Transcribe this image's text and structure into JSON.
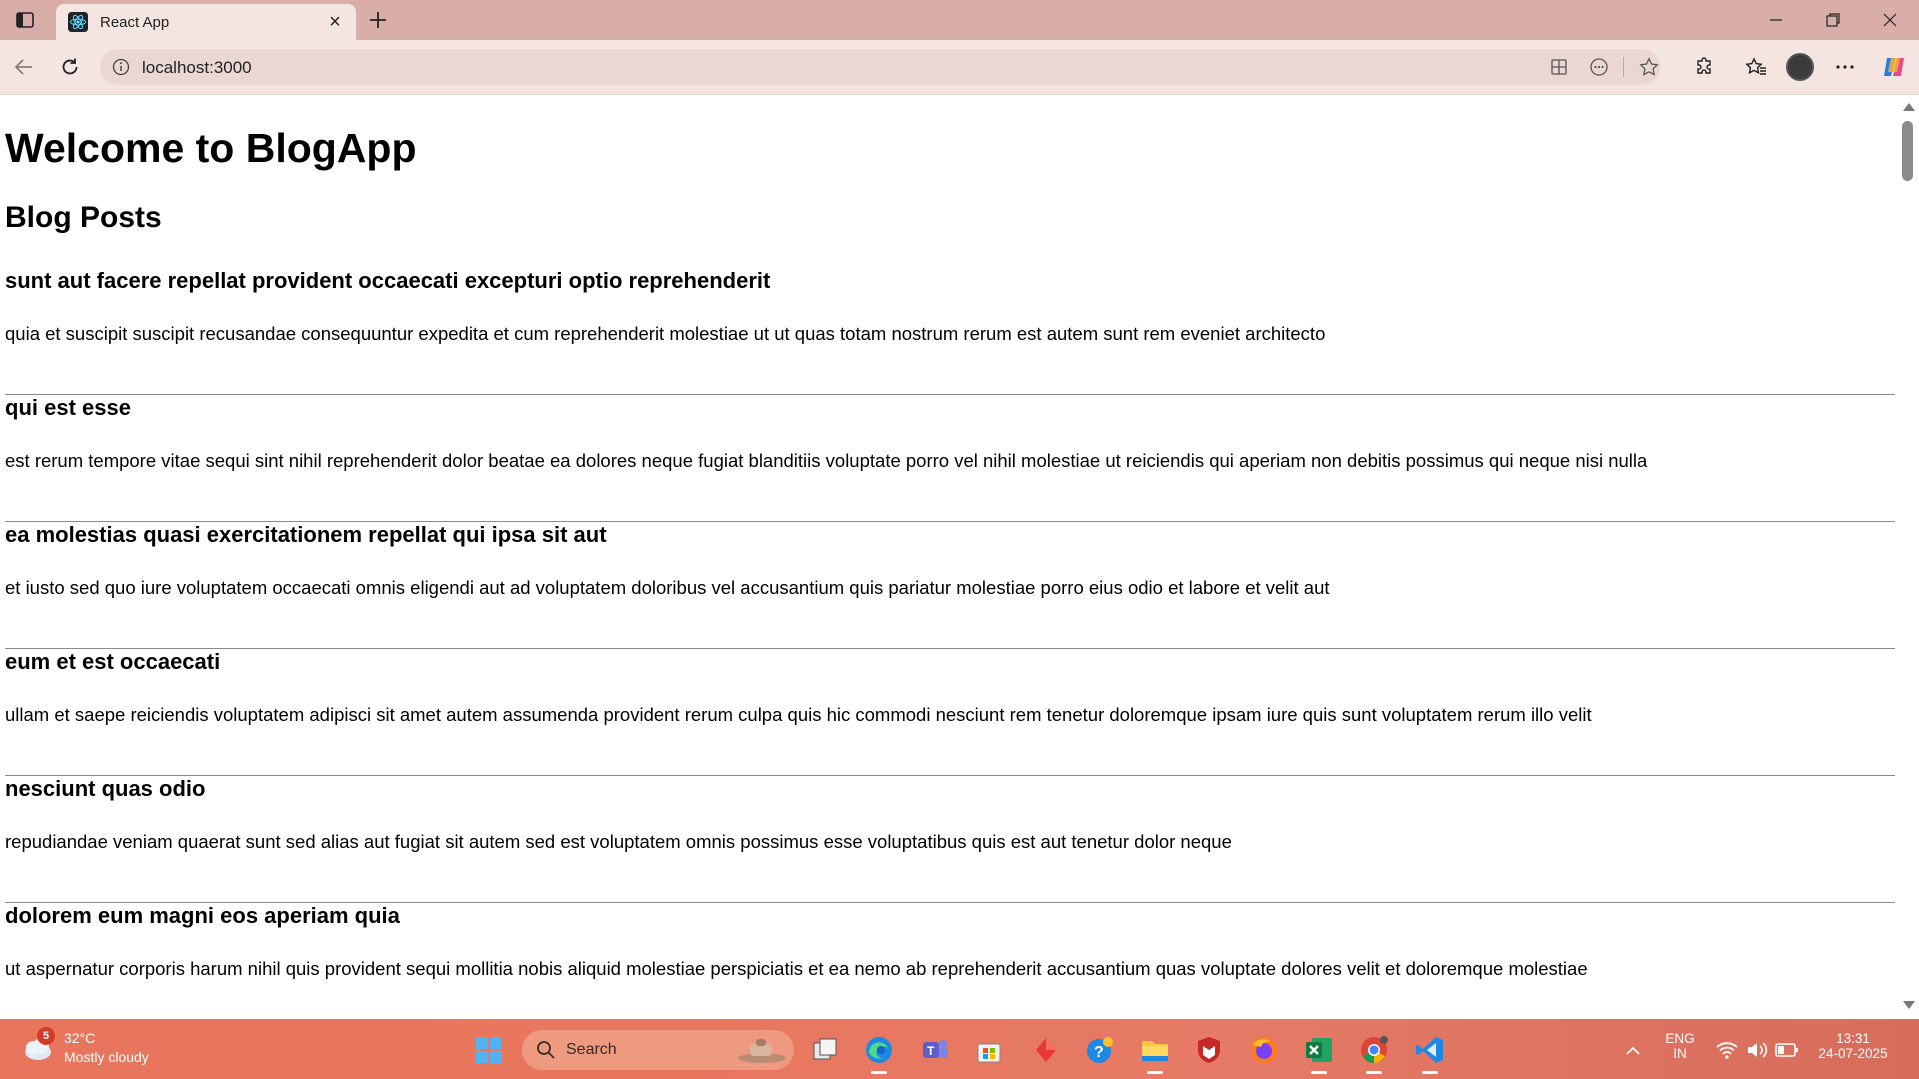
{
  "browser": {
    "tab_title": "React App",
    "tab_close": "×",
    "url": "localhost:3000"
  },
  "page": {
    "heading": "Welcome to BlogApp",
    "subheading": "Blog Posts",
    "posts": [
      {
        "title": "sunt aut facere repellat provident occaecati excepturi optio reprehenderit",
        "body": "quia et suscipit suscipit recusandae consequuntur expedita et cum reprehenderit molestiae ut ut quas totam nostrum rerum est autem sunt rem eveniet architecto"
      },
      {
        "title": "qui est esse",
        "body": "est rerum tempore vitae sequi sint nihil reprehenderit dolor beatae ea dolores neque fugiat blanditiis voluptate porro vel nihil molestiae ut reiciendis qui aperiam non debitis possimus qui neque nisi nulla"
      },
      {
        "title": "ea molestias quasi exercitationem repellat qui ipsa sit aut",
        "body": "et iusto sed quo iure voluptatem occaecati omnis eligendi aut ad voluptatem doloribus vel accusantium quis pariatur molestiae porro eius odio et labore et velit aut"
      },
      {
        "title": "eum et est occaecati",
        "body": "ullam et saepe reiciendis voluptatem adipisci sit amet autem assumenda provident rerum culpa quis hic commodi nesciunt rem tenetur doloremque ipsam iure quis sunt voluptatem rerum illo velit"
      },
      {
        "title": "nesciunt quas odio",
        "body": "repudiandae veniam quaerat sunt sed alias aut fugiat sit autem sed est voluptatem omnis possimus esse voluptatibus quis est aut tenetur dolor neque"
      },
      {
        "title": "dolorem eum magni eos aperiam quia",
        "body": "ut aspernatur corporis harum nihil quis provident sequi mollitia nobis aliquid molestiae perspiciatis et ea nemo ab reprehenderit accusantium quas voluptate dolores velit et doloremque molestiae"
      }
    ]
  },
  "taskbar": {
    "weather_badge": "5",
    "weather_temp": "32°C",
    "weather_desc": "Mostly cloudy",
    "search_label": "Search",
    "lang_line1": "ENG",
    "lang_line2": "IN",
    "time": "13:31",
    "date": "24-07-2025"
  },
  "colors": {
    "titlebar": "#d9aea9",
    "toolbar": "#f4e4e2",
    "taskbar": "#e8765c",
    "react_logo": "#61dafb"
  },
  "icons": [
    "sidebar-icon",
    "react-favicon",
    "close-icon",
    "plus-icon",
    "minimize-icon",
    "restore-icon",
    "window-close-icon",
    "back-icon",
    "refresh-icon",
    "info-icon",
    "split-screen-icon",
    "read-aloud-icon",
    "star-icon",
    "extensions-icon",
    "favorites-icon",
    "profile-avatar",
    "more-icon",
    "copilot-icon",
    "windows-start-icon",
    "search-icon",
    "task-view-icon",
    "edge-icon",
    "teams-icon",
    "store-icon",
    "app-icon",
    "help-icon",
    "file-explorer-icon",
    "mcafee-icon",
    "firefox-icon",
    "excel-icon",
    "chrome-icon",
    "vscode-icon",
    "chevron-up-icon",
    "wifi-icon",
    "volume-icon",
    "battery-icon"
  ]
}
